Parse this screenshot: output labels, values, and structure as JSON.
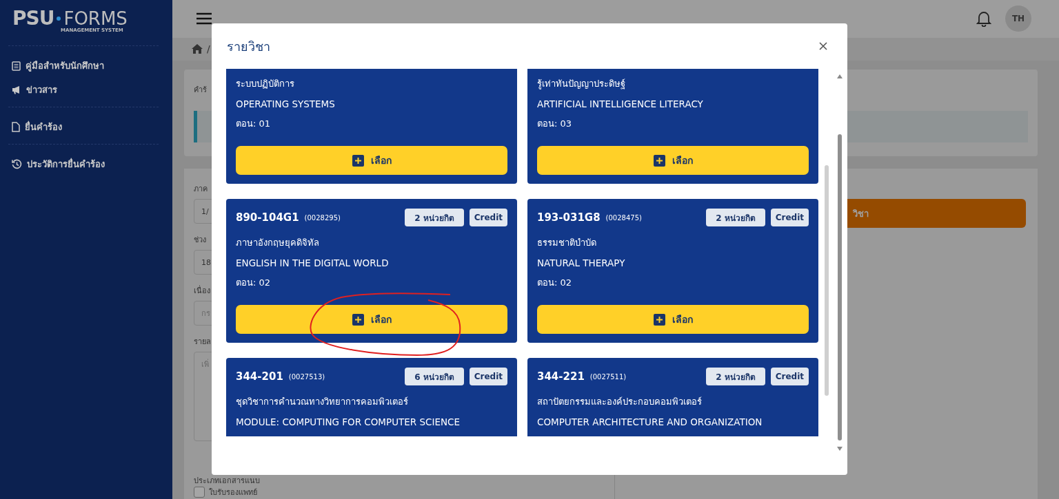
{
  "sidebar": {
    "logo": {
      "brand_left": "PSU",
      "brand_right": "FORMS",
      "tagline": "MANAGEMENT SYSTEM"
    },
    "groups": [
      [
        {
          "label": "คู่มือสำหรับนักศึกษา"
        },
        {
          "label": "ข่าวสาร"
        }
      ],
      [
        {
          "label": "ยื่นคำร้อง"
        }
      ],
      [
        {
          "label": "ประวัติการยื่นคำร้อง"
        }
      ]
    ]
  },
  "topbar": {
    "avatar": "TH"
  },
  "breadcrumb": {
    "separator": "/"
  },
  "background": {
    "request_title": "คำร้",
    "fields": [
      {
        "label": "ภาค",
        "value": "1/",
        "kind": "input"
      },
      {
        "label": "ช่วง",
        "value": "18",
        "kind": "input"
      },
      {
        "label": "เนื่อง",
        "placeholder": "กร",
        "kind": "input"
      },
      {
        "label": "รายล",
        "placeholder": "เพิ่",
        "kind": "textarea"
      }
    ],
    "attachment_label": "ประเภทเอกสารแนบ",
    "attachment_option": {
      "label": "ใบรับรองแพทย์",
      "checked": false
    },
    "action_button": "วิชา"
  },
  "modal": {
    "title": "รายวิชา",
    "cards": [
      {
        "name_th": "ระบบปฏิบัติการ",
        "name_en": "OPERATING SYSTEMS",
        "section": "ตอน: 01",
        "select_label": "เลือก"
      },
      {
        "name_th": "รู้เท่าทันปัญญาประดิษฐ์",
        "name_en": "ARTIFICIAL INTELLIGENCE LITERACY",
        "section": "ตอน: 03",
        "select_label": "เลือก"
      },
      {
        "code": "890-104G1",
        "id": "(0028295)",
        "units": "2 หน่วยกิต",
        "credit": "Credit",
        "name_th": "ภาษาอังกฤษยุคดิจิทัล",
        "name_en": "ENGLISH IN THE DIGITAL WORLD",
        "section": "ตอน: 02",
        "select_label": "เลือก"
      },
      {
        "code": "193-031G8",
        "id": "(0028475)",
        "units": "2 หน่วยกิต",
        "credit": "Credit",
        "name_th": "ธรรมชาติบำบัด",
        "name_en": "NATURAL THERAPY",
        "section": "ตอน: 02",
        "select_label": "เลือก"
      },
      {
        "code": "344-201",
        "id": "(0027513)",
        "units": "6 หน่วยกิต",
        "credit": "Credit",
        "name_th": "ชุดวิชาการคำนวณทางวิทยาการคอมพิวเตอร์",
        "name_en": "MODULE: COMPUTING FOR COMPUTER SCIENCE"
      },
      {
        "code": "344-221",
        "id": "(0027511)",
        "units": "2 หน่วยกิต",
        "credit": "Credit",
        "name_th": "สถาปัตยกรรมและองค์ประกอบคอมพิวเตอร์",
        "name_en": "COMPUTER ARCHITECTURE AND ORGANIZATION"
      }
    ]
  }
}
